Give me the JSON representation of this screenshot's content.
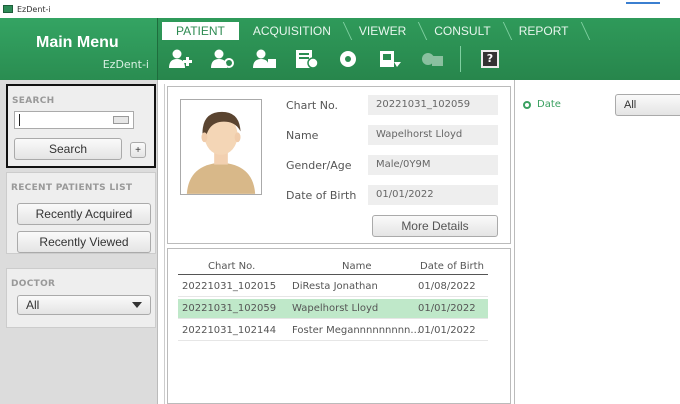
{
  "window": {
    "title": "EzDent-i"
  },
  "main_menu": {
    "title": "Main Menu",
    "subtitle": "EzDent-i"
  },
  "tabs": [
    {
      "label": "PATIENT",
      "active": true
    },
    {
      "label": "ACQUISITION",
      "active": false
    },
    {
      "label": "VIEWER",
      "active": false
    },
    {
      "label": "CONSULT",
      "active": false
    },
    {
      "label": "REPORT",
      "active": false
    }
  ],
  "toolbar": {
    "icons": [
      "add-patient-icon",
      "edit-patient-icon",
      "delete-patient-icon",
      "patient-card-icon",
      "network-icon",
      "import-icon",
      "export-icon",
      "help-icon"
    ],
    "help_label": "?"
  },
  "search": {
    "section_label": "SEARCH",
    "input_value": "",
    "button_label": "Search",
    "plus_label": "+"
  },
  "recent": {
    "section_label": "RECENT PATIENTS LIST",
    "acquired_label": "Recently Acquired",
    "viewed_label": "Recently Viewed"
  },
  "doctor": {
    "section_label": "DOCTOR",
    "selected": "All"
  },
  "patient": {
    "fields": [
      {
        "label": "Chart No.",
        "value": "20221031_102059"
      },
      {
        "label": "Name",
        "value": "Wapelhorst Lloyd"
      },
      {
        "label": "Gender/Age",
        "value": "Male/0Y9M"
      },
      {
        "label": "Date of Birth",
        "value": "01/01/2022"
      }
    ],
    "more_label": "More Details"
  },
  "patient_list": {
    "headers": [
      "Chart No.",
      "Name",
      "Date of Birth"
    ],
    "rows": [
      {
        "chart": "20221031_102015",
        "name": "DiResta Jonathan",
        "dob": "01/08/2022",
        "selected": false
      },
      {
        "chart": "20221031_102059",
        "name": "Wapelhorst Lloyd",
        "dob": "01/01/2022",
        "selected": true
      },
      {
        "chart": "20221031_102144",
        "name": "Foster Megannnnnnnnn...",
        "dob": "01/01/2022",
        "selected": false
      }
    ]
  },
  "right_panel": {
    "date_label": "Date",
    "date_filter": "All"
  },
  "colors": {
    "brand_green": "#2f9a5a",
    "selected_row": "#bfe8c9"
  }
}
